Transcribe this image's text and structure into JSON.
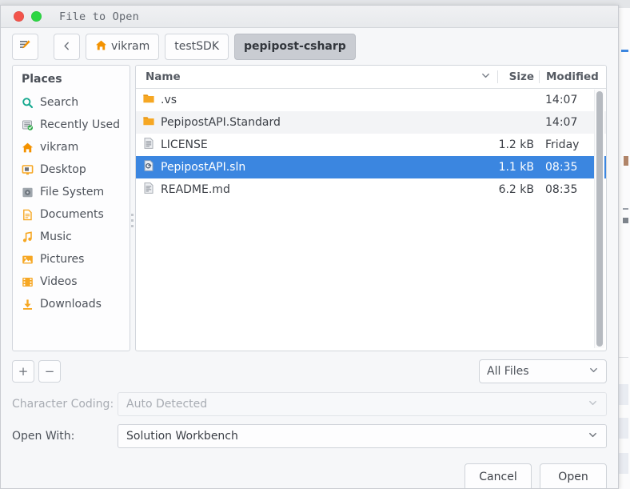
{
  "window": {
    "title": "File to Open",
    "close_label": "close",
    "maximize_label": "maximize"
  },
  "toolbar": {
    "location_button_title": "Type a file name",
    "back_button_label": "‹",
    "breadcrumbs": [
      {
        "label": "vikram",
        "icon": "home-icon",
        "active": false
      },
      {
        "label": "testSDK",
        "icon": "",
        "active": false
      },
      {
        "label": "pepipost-csharp",
        "icon": "",
        "active": true
      }
    ]
  },
  "sidebar": {
    "heading": "Places",
    "items": [
      {
        "label": "Search",
        "icon": "search-icon"
      },
      {
        "label": "Recently Used",
        "icon": "recent-icon"
      },
      {
        "label": "vikram",
        "icon": "home-icon"
      },
      {
        "label": "Desktop",
        "icon": "desktop-icon"
      },
      {
        "label": "File System",
        "icon": "drive-icon"
      },
      {
        "label": "Documents",
        "icon": "document-icon"
      },
      {
        "label": "Music",
        "icon": "music-icon"
      },
      {
        "label": "Pictures",
        "icon": "picture-icon"
      },
      {
        "label": "Videos",
        "icon": "video-icon"
      },
      {
        "label": "Downloads",
        "icon": "download-icon"
      }
    ],
    "add_button_label": "+",
    "remove_button_label": "−"
  },
  "filelist": {
    "columns": {
      "name": "Name",
      "size": "Size",
      "modified": "Modified"
    },
    "sort_indicator": "chevron-down-icon",
    "rows": [
      {
        "name": ".vs",
        "size": "",
        "modified": "14:07",
        "type": "folder",
        "selected": false
      },
      {
        "name": "PepipostAPI.Standard",
        "size": "",
        "modified": "14:07",
        "type": "folder",
        "selected": false
      },
      {
        "name": "LICENSE",
        "size": "1.2 kB",
        "modified": "Friday",
        "type": "text",
        "selected": false
      },
      {
        "name": "PepipostAPI.sln",
        "size": "1.1 kB",
        "modified": "08:35",
        "type": "solution",
        "selected": true
      },
      {
        "name": "README.md",
        "size": "6.2 kB",
        "modified": "08:35",
        "type": "text",
        "selected": false
      }
    ]
  },
  "filter": {
    "selected": "All Files",
    "chevron": "chevron-down-icon"
  },
  "fields": {
    "charset_label": "Character Coding:",
    "charset_value": "Auto Detected",
    "openwith_label": "Open With:",
    "openwith_value": "Solution Workbench"
  },
  "actions": {
    "cancel_label": "Cancel",
    "open_label": "Open"
  },
  "colors": {
    "selection": "#3b86e0",
    "folder": "#f6a723",
    "accent_orange": "#f39200"
  }
}
